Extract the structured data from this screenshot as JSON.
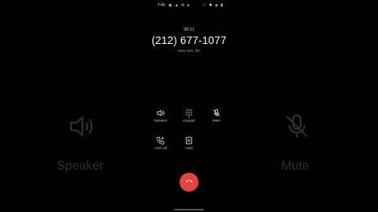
{
  "status_bar": {
    "time": "7:45"
  },
  "call": {
    "timer": "00:11",
    "number": "(212) 677-1077",
    "location": "New York, NY"
  },
  "controls": {
    "speaker": "Speaker",
    "keypad": "Keypad",
    "mute": "Mute",
    "add_call": "Add call",
    "hold": "Hold"
  },
  "background": {
    "speaker_label": "Speaker",
    "mute_label": "Mute"
  },
  "colors": {
    "end_call": "#e5433d",
    "background": "#000000"
  }
}
